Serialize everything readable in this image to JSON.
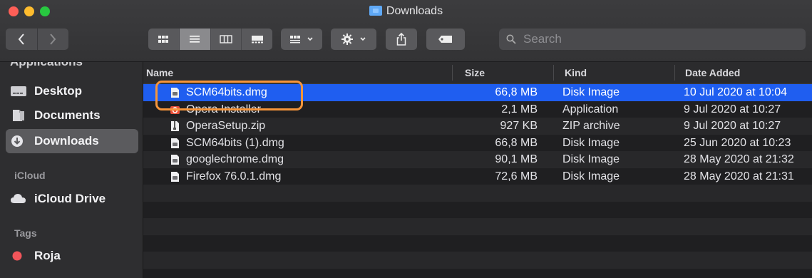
{
  "window": {
    "title": "Downloads"
  },
  "toolbar": {
    "back_icon": "chevron-left-icon",
    "forward_icon": "chevron-right-icon",
    "view_modes": [
      "icon-view-icon",
      "list-view-icon",
      "column-view-icon",
      "gallery-view-icon"
    ],
    "group_icon": "group-by-icon",
    "action_icon": "gear-icon",
    "share_icon": "share-icon",
    "tag_icon": "tag-icon",
    "search_placeholder": "Search"
  },
  "sidebar": {
    "cut_item": "Applications",
    "favorites": [
      {
        "label": "Desktop",
        "icon": "desktop-folder-icon"
      },
      {
        "label": "Documents",
        "icon": "documents-folder-icon"
      },
      {
        "label": "Downloads",
        "icon": "downloads-icon",
        "selected": true
      }
    ],
    "icloud_header": "iCloud",
    "icloud_items": [
      {
        "label": "iCloud Drive",
        "icon": "cloud-icon"
      }
    ],
    "tags_header": "Tags",
    "tags": [
      {
        "label": "Roja",
        "color": "#f2555a"
      }
    ]
  },
  "columns": {
    "name": "Name",
    "size": "Size",
    "kind": "Kind",
    "date": "Date Added"
  },
  "files": [
    {
      "name": "SCM64bits.dmg",
      "size": "66,8 MB",
      "kind": "Disk Image",
      "date": "10 Jul 2020 at 10:04",
      "icon": "disk-image-icon",
      "selected": true
    },
    {
      "name": "Opera Installer",
      "size": "2,1 MB",
      "kind": "Application",
      "date": "9 Jul 2020 at 10:27",
      "icon": "opera-app-icon"
    },
    {
      "name": "OperaSetup.zip",
      "size": "927 KB",
      "kind": "ZIP archive",
      "date": "9 Jul 2020 at 10:27",
      "icon": "zip-archive-icon"
    },
    {
      "name": "SCM64bits (1).dmg",
      "size": "66,8 MB",
      "kind": "Disk Image",
      "date": "25 Jun 2020 at 10:23",
      "icon": "disk-image-icon"
    },
    {
      "name": "googlechrome.dmg",
      "size": "90,1 MB",
      "kind": "Disk Image",
      "date": "28 May 2020 at 21:32",
      "icon": "disk-image-icon"
    },
    {
      "name": "Firefox 76.0.1.dmg",
      "size": "72,6 MB",
      "kind": "Disk Image",
      "date": "28 May 2020 at 21:31",
      "icon": "disk-image-icon"
    }
  ],
  "colors": {
    "selection": "#1f5ef0",
    "highlight": "#f7953a"
  }
}
